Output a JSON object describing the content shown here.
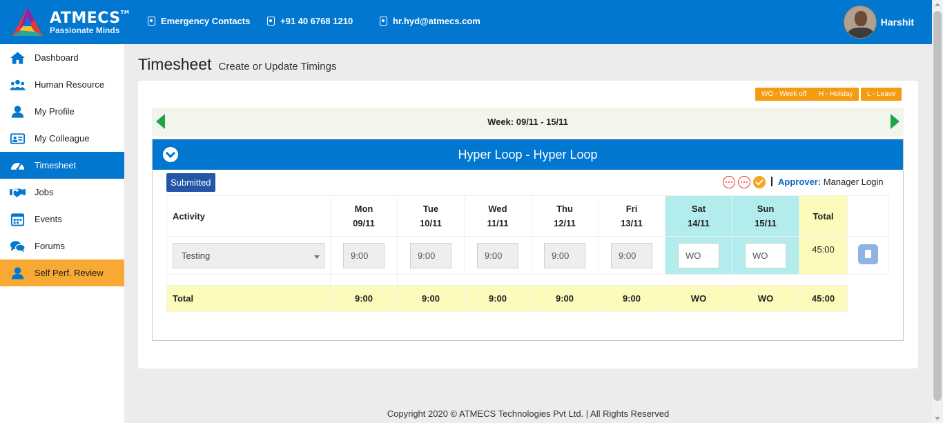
{
  "brand": {
    "name": "ATMECS",
    "tm": "TM",
    "tagline": "Passionate Minds"
  },
  "header": {
    "contacts": [
      {
        "icon": "contact-card-icon",
        "label": "Emergency Contacts"
      },
      {
        "icon": "contact-card-icon",
        "label": "+91 40 6768 1210"
      },
      {
        "icon": "contact-card-icon",
        "label": "hr.hyd@atmecs.com"
      }
    ],
    "user": {
      "name": "Harshit"
    }
  },
  "sidebar": {
    "items": [
      {
        "label": "Dashboard",
        "icon": "home-icon"
      },
      {
        "label": "Human Resource",
        "icon": "users-icon"
      },
      {
        "label": "My Profile",
        "icon": "user-icon"
      },
      {
        "label": "My Colleague",
        "icon": "id-card-icon"
      },
      {
        "label": "Timesheet",
        "icon": "gauge-icon",
        "active": true
      },
      {
        "label": "Jobs",
        "icon": "handshake-icon"
      },
      {
        "label": "Events",
        "icon": "calendar-icon"
      },
      {
        "label": "Forums",
        "icon": "chat-icon"
      },
      {
        "label": "Self Perf. Review",
        "icon": "user-icon",
        "highlight": true
      }
    ]
  },
  "page": {
    "title": "Timesheet",
    "subtitle": "Create or Update Timings"
  },
  "legend": [
    {
      "label": "WO - Week off"
    },
    {
      "label": "H - Holiday"
    },
    {
      "label": "L - Leave"
    }
  ],
  "week": {
    "label": "Week: 09/11 - 15/11"
  },
  "project": {
    "title": "Hyper Loop - Hyper Loop",
    "status": "Submitted",
    "approver_label": "Approver:",
    "approver_name": "Manager Login"
  },
  "table": {
    "activity_header": "Activity",
    "total_header": "Total",
    "days": [
      {
        "name": "Mon",
        "date": "09/11"
      },
      {
        "name": "Tue",
        "date": "10/11"
      },
      {
        "name": "Wed",
        "date": "11/11"
      },
      {
        "name": "Thu",
        "date": "12/11"
      },
      {
        "name": "Fri",
        "date": "13/11"
      },
      {
        "name": "Sat",
        "date": "14/11"
      },
      {
        "name": "Sun",
        "date": "15/11"
      }
    ],
    "row": {
      "activity": "Testing",
      "hours": [
        "9:00",
        "9:00",
        "9:00",
        "9:00",
        "9:00",
        "WO",
        "WO"
      ],
      "total": "45:00"
    },
    "footer": {
      "label": "Total",
      "values": [
        "9:00",
        "9:00",
        "9:00",
        "9:00",
        "9:00",
        "WO",
        "WO"
      ],
      "total": "45:00"
    }
  },
  "footer": {
    "text": "Copyright 2020 © ATMECS Technologies Pvt Ltd. | All Rights Reserved"
  },
  "colors": {
    "primary": "#0277d0",
    "accent": "#f7a933",
    "legend": "#f39c12",
    "weekend": "#b3ecec",
    "total": "#fdfbbb",
    "nav_arrow": "#1ea34a",
    "status_badge": "#2356a6"
  }
}
